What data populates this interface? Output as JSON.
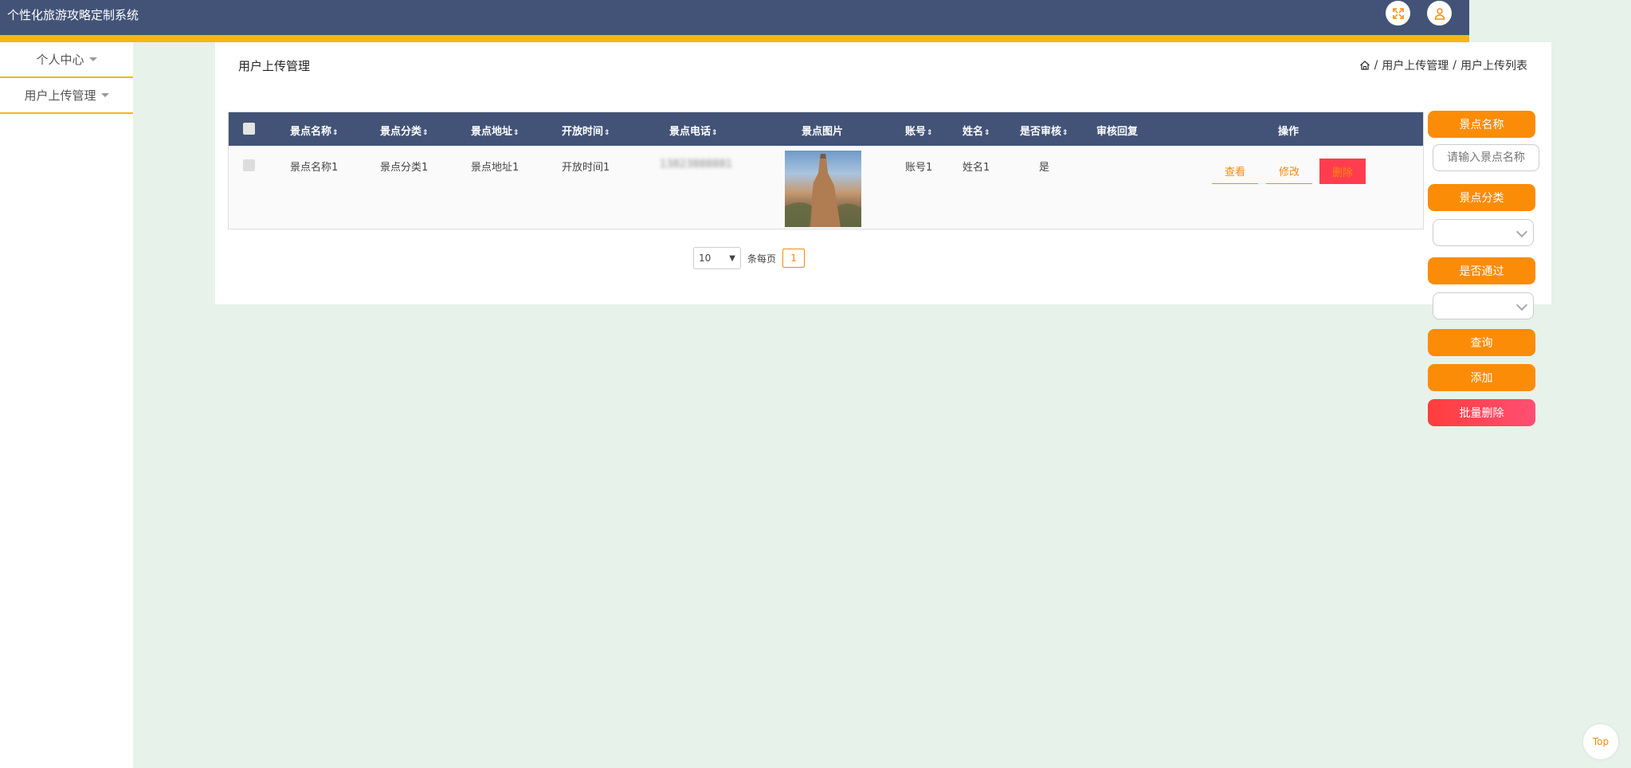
{
  "app": {
    "title": "个性化旅游攻略定制系统"
  },
  "header": {
    "fullscreen_icon": "fullscreen-icon",
    "user_icon": "user-icon"
  },
  "sidebar": {
    "items": [
      {
        "label": "个人中心"
      },
      {
        "label": "用户上传管理"
      }
    ]
  },
  "page": {
    "title": "用户上传管理",
    "breadcrumb": {
      "home_icon": "home-icon",
      "sep": "/",
      "level1": "用户上传管理",
      "level2": "用户上传列表"
    }
  },
  "table": {
    "columns": [
      "景点名称",
      "景点分类",
      "景点地址",
      "开放时间",
      "景点电话",
      "景点图片",
      "账号",
      "姓名",
      "是否审核",
      "审核回复",
      "操作"
    ],
    "sort_icon": "⇕",
    "rows": [
      {
        "name": "景点名称1",
        "category": "景点分类1",
        "address": "景点地址1",
        "open_time": "开放时间1",
        "phone": "13823888881",
        "account": "账号1",
        "realname": "姓名1",
        "reviewed": "是",
        "reply": ""
      }
    ],
    "actions": {
      "view": "查看",
      "edit": "修改",
      "delete": "删除"
    }
  },
  "pagination": {
    "page_size": "10",
    "per_page_label": "条每页",
    "current_page": "1"
  },
  "filters": {
    "name_label": "景点名称",
    "name_placeholder": "请输入景点名称",
    "category_label": "景点分类",
    "passed_label": "是否通过",
    "query_label": "查询",
    "add_label": "添加",
    "batch_delete_label": "批量删除"
  },
  "back_to_top": "Top",
  "colors": {
    "header": "#425377",
    "accent": "#f7b514",
    "orange": "#fb8c07",
    "danger": "#ff3d4f",
    "background": "#e6f2ea"
  }
}
